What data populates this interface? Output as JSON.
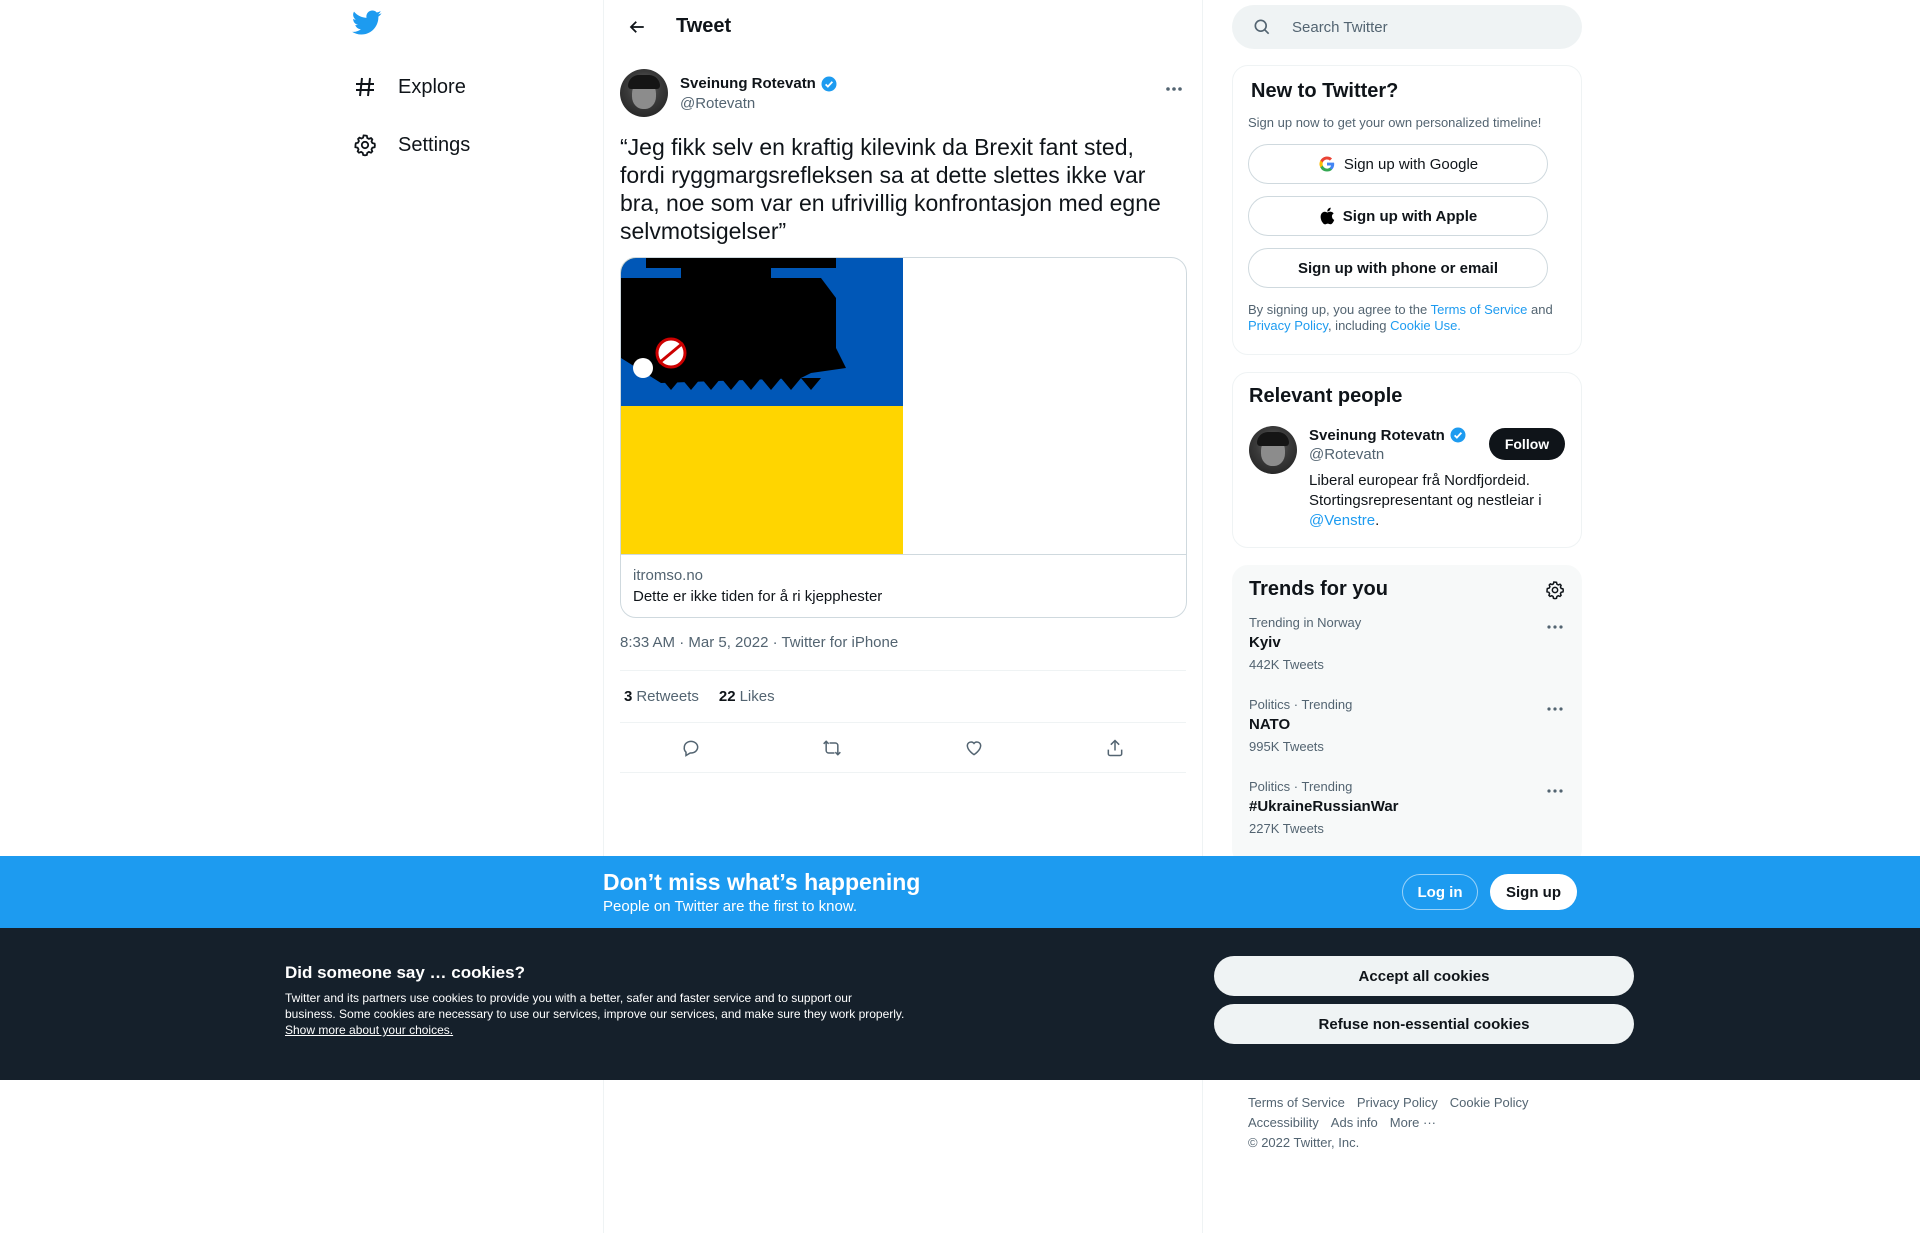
{
  "nav": {
    "logo_icon": "twitter-bird-icon",
    "items": [
      {
        "label": "Explore",
        "icon": "hashtag-icon"
      },
      {
        "label": "Settings",
        "icon": "gear-icon"
      }
    ]
  },
  "header": {
    "title": "Tweet",
    "back_icon": "arrow-left-icon"
  },
  "tweet": {
    "author_name": "Sveinung Rotevatn",
    "author_handle": "@Rotevatn",
    "text": "“Jeg fikk selv en kraftig kilevink da Brexit fant sted, fordi ryggmargsrefleksen sa at dette slettes ikke var bra, noe som var en ufrivillig konfrontasjon med egne selvmotsigelser”",
    "card": {
      "domain": "itromso.no",
      "title": "Dette er ikke tiden for å ri kjepphester"
    },
    "timestamp": "8:33 AM · Mar 5, 2022 · Twitter for iPhone",
    "retweets_count": "3",
    "retweets_label": "Retweets",
    "likes_count": "22",
    "likes_label": "Likes"
  },
  "search": {
    "placeholder": "Search Twitter"
  },
  "new_to_twitter": {
    "title": "New to Twitter?",
    "subtitle": "Sign up now to get your own personalized timeline!",
    "google_label": "Sign up with Google",
    "apple_label": "Sign up with Apple",
    "phone_label": "Sign up with phone or email",
    "legal_pre": "By signing up, you agree to the ",
    "tos": "Terms of Service",
    "and": " and ",
    "privacy": "Privacy Policy",
    "including": ", including ",
    "cookie_use": "Cookie Use."
  },
  "relevant": {
    "title": "Relevant people",
    "name": "Sveinung Rotevatn",
    "handle": "@Rotevatn",
    "follow_label": "Follow",
    "bio": "Liberal europear frå Nordfjordeid. Stortingsrepresentant og nestleiar i ",
    "bio_link": "@Venstre",
    "bio_end": "."
  },
  "trends": {
    "title": "Trends for you",
    "items": [
      {
        "context": "Trending in Norway",
        "name": "Kyiv",
        "count": "442K Tweets"
      },
      {
        "context": "Politics · Trending",
        "name": "NATO",
        "count": "995K Tweets"
      },
      {
        "context": "Politics · Trending",
        "name": "#UkraineRussianWar",
        "count": "227K Tweets"
      }
    ]
  },
  "footer": {
    "terms": "Terms of Service",
    "privacy": "Privacy Policy",
    "cookie": "Cookie Policy",
    "accessibility": "Accessibility",
    "ads": "Ads info",
    "more": "More ···",
    "copyright": "© 2022 Twitter, Inc."
  },
  "bottom_bar": {
    "title": "Don’t miss what’s happening",
    "subtitle": "People on Twitter are the first to know.",
    "login_label": "Log in",
    "signup_label": "Sign up"
  },
  "cookie_banner": {
    "title": "Did someone say … cookies?",
    "text": "Twitter and its partners use cookies to provide you with a better, safer and faster service and to support our business. Some cookies are necessary to use our services, improve our services, and make sure they work properly. ",
    "link": "Show more about your choices.",
    "accept_label": "Accept all cookies",
    "refuse_label": "Refuse non-essential cookies"
  },
  "colors": {
    "accent": "#1d9bf0",
    "text": "#0f1419",
    "muted": "#536471",
    "banner": "#15202b"
  }
}
